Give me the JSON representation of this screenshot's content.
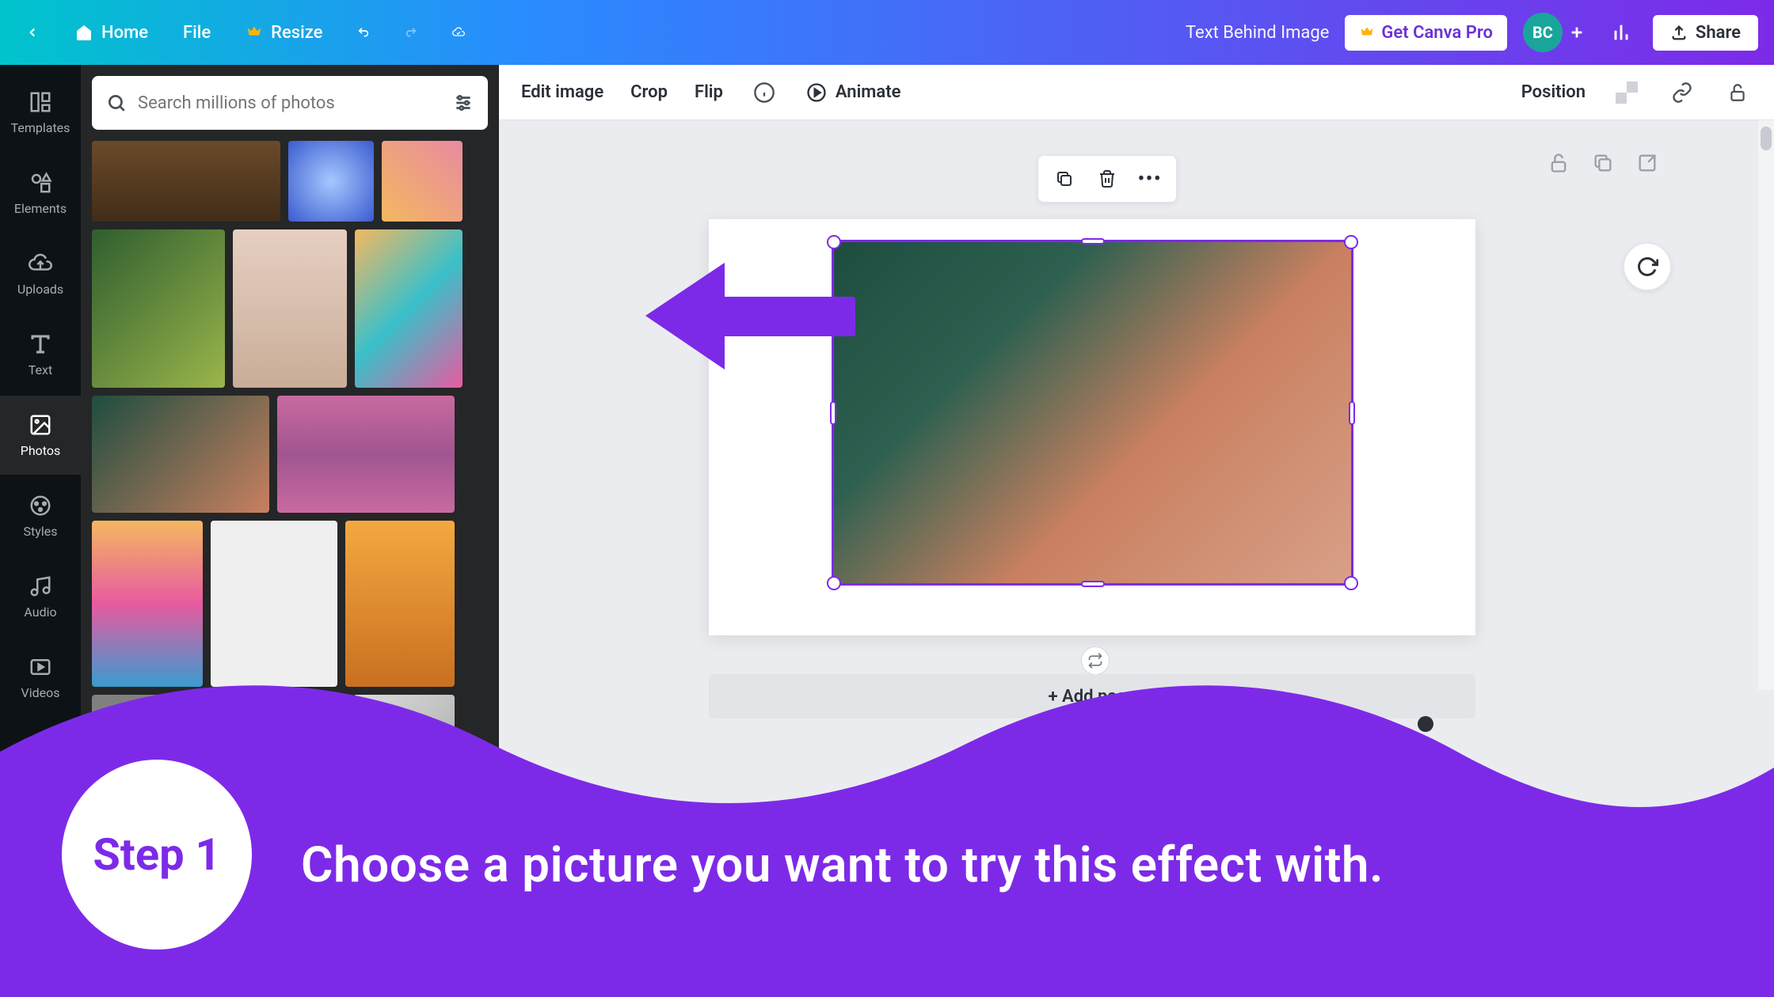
{
  "topbar": {
    "home": "Home",
    "file": "File",
    "resize": "Resize",
    "doc_title": "Text Behind Image",
    "pro_label": "Get Canva Pro",
    "share_label": "Share",
    "avatar_initials": "BC"
  },
  "leftrail": {
    "items": [
      {
        "label": "Templates",
        "icon": "templates-icon"
      },
      {
        "label": "Elements",
        "icon": "elements-icon"
      },
      {
        "label": "Uploads",
        "icon": "uploads-icon"
      },
      {
        "label": "Text",
        "icon": "text-icon"
      },
      {
        "label": "Photos",
        "icon": "photos-icon",
        "active": true
      },
      {
        "label": "Styles",
        "icon": "styles-icon"
      },
      {
        "label": "Audio",
        "icon": "audio-icon"
      },
      {
        "label": "Videos",
        "icon": "videos-icon"
      }
    ]
  },
  "search": {
    "placeholder": "Search millions of photos"
  },
  "ctxbar": {
    "edit_image": "Edit image",
    "crop": "Crop",
    "flip": "Flip",
    "animate": "Animate",
    "position": "Position"
  },
  "canvas": {
    "add_page": "+ Add page"
  },
  "overlay": {
    "step_label": "Step 1",
    "step_text": "Choose a picture you want to try this effect with.",
    "accent_color": "#7d2ae8"
  }
}
